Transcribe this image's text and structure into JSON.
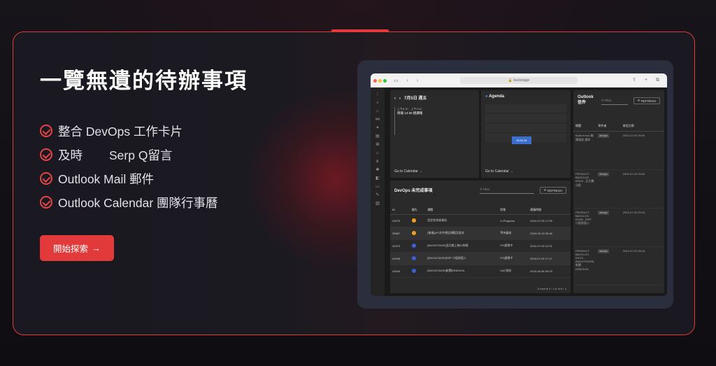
{
  "headline": "一覽無遺的待辦事項",
  "features": [
    {
      "label": "整合 DevOps 工作卡片"
    },
    {
      "label_a": "及時",
      "label_b": "Serp Q留言"
    },
    {
      "label": "Outlook Mail 郵件"
    },
    {
      "label": "Outlook Calendar 團隊行事曆"
    }
  ],
  "cta": {
    "label": "開始探索",
    "arrow": "→"
  },
  "colors": {
    "accent": "#e23a3a",
    "card_border": "#e03a3a",
    "link": "#7aa8ff"
  },
  "browser": {
    "url": "backstage",
    "calendar": {
      "nav_prev": "‹",
      "nav_next": "›",
      "date_title": "7月5日 週五",
      "event_time": "上午8:30 - 上午9:00",
      "event_title": "周報 14:30 組讀報",
      "go_link": "Go to Calendar →"
    },
    "agenda": {
      "title": "Agenda",
      "sign_in": "SIGN IN",
      "go_link": "Go to Calendar →"
    },
    "devops": {
      "title": "DevOps 未完成事項",
      "filter_placeholder": "Filter",
      "refresh": "REFRESH",
      "columns": [
        "ID",
        "優先",
        "標題",
        "狀態",
        "建議時間"
      ],
      "rows": [
        {
          "id": "43475",
          "title": "設定各系統資料",
          "state": "In Progress",
          "date": "2024-07-03 17:25",
          "pri_color": "#f0a020"
        },
        {
          "id": "39667",
          "title": "[後端]API文件標記規範及版本",
          "state": "等待審核",
          "date": "2024-06-13 09:48",
          "pri_color": "#f0a020"
        },
        {
          "id": "43470",
          "title": "[BACKSTAGE]此功能上線公佈版",
          "state": "PG處理中",
          "date": "2024-07-03 12:01",
          "pri_color": "#3a5fd8"
        },
        {
          "id": "43166",
          "title": "[BACKSTAGE]ERP 小組頁面入",
          "state": "PG處理中",
          "date": "2024-07-02 17:17",
          "pri_color": "#3a5fd8"
        },
        {
          "id": "41616",
          "title": "[BACKSTAGE]新聞DRAFAXA",
          "state": "UAT測試",
          "date": "2024-06-06 09:23",
          "pri_color": "#3a5fd8"
        }
      ],
      "pager": "5 rows ▾     |‹   ‹   1-5 of 8   ›   ›|"
    },
    "outlook": {
      "title": "Outlook 信件",
      "filter_placeholder": "Filter",
      "refresh": "REFRESH",
      "columns": [
        "標題",
        "寄件者",
        "收信日期"
      ],
      "rows": [
        {
          "subject": "Build errors 編譯錯誤 通知",
          "sender": "devops",
          "date": "2024-07-02 09:40"
        },
        {
          "subject": "PRODUCT BACKLOG 61100 - 正式機 分配",
          "sender": "devops",
          "date": "2024-07-02 09:40"
        },
        {
          "subject": "PRODUCT BACKLOG 61180 - ERP 小組頁面入",
          "sender": "devops",
          "date": "2024-07-02 09:18"
        },
        {
          "subject": "PRODUCT BACKLOG 61070 - [BACKSTAGE]新聞DRAFAXA",
          "sender": "devops",
          "date": "2024-07-02 09:18"
        }
      ]
    }
  }
}
